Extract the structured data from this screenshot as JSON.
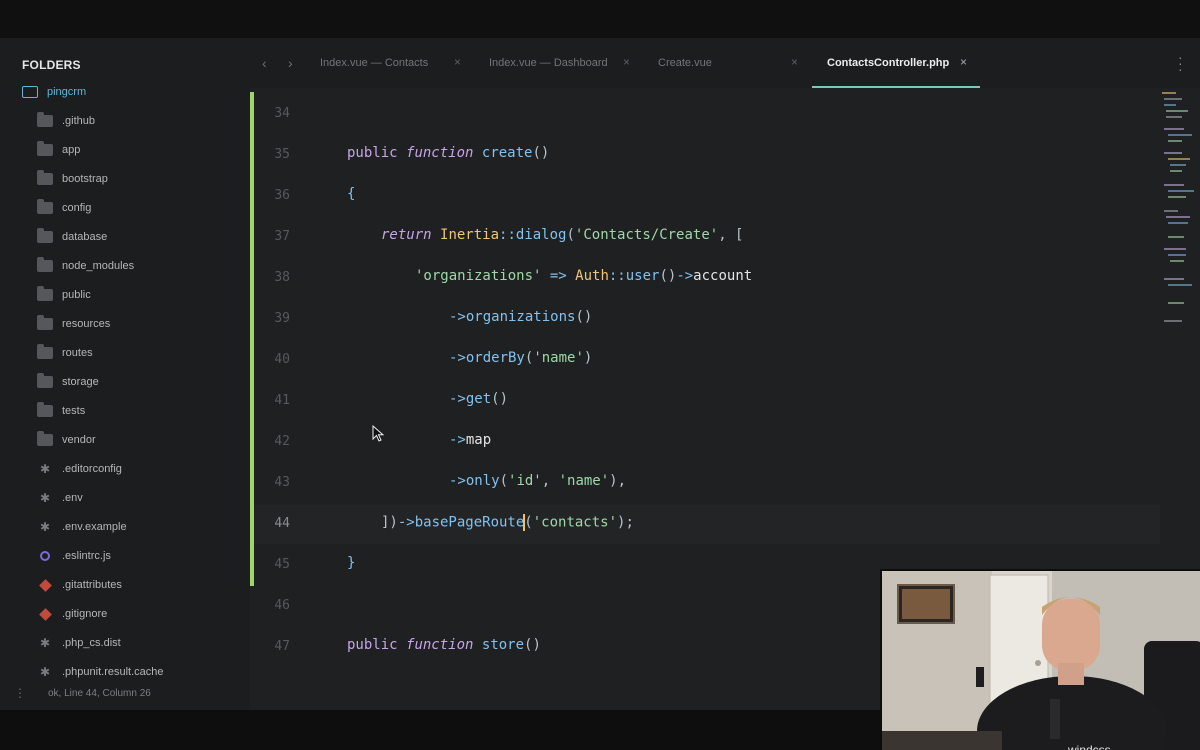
{
  "sidebar": {
    "header": "FOLDERS",
    "root": "pingcrm",
    "items": [
      {
        "label": ".github",
        "icon": "folder-icon"
      },
      {
        "label": "app",
        "icon": "folder-icon"
      },
      {
        "label": "bootstrap",
        "icon": "folder-icon"
      },
      {
        "label": "config",
        "icon": "folder-icon"
      },
      {
        "label": "database",
        "icon": "folder-icon"
      },
      {
        "label": "node_modules",
        "icon": "folder-icon"
      },
      {
        "label": "public",
        "icon": "folder-icon"
      },
      {
        "label": "resources",
        "icon": "folder-icon"
      },
      {
        "label": "routes",
        "icon": "folder-icon"
      },
      {
        "label": "storage",
        "icon": "folder-icon"
      },
      {
        "label": "tests",
        "icon": "folder-icon"
      },
      {
        "label": "vendor",
        "icon": "folder-icon"
      },
      {
        "label": ".editorconfig",
        "icon": "file-star-icon"
      },
      {
        "label": ".env",
        "icon": "file-star-icon"
      },
      {
        "label": ".env.example",
        "icon": "file-star-icon"
      },
      {
        "label": ".eslintrc.js",
        "icon": "eslint-icon"
      },
      {
        "label": ".gitattributes",
        "icon": "git-icon"
      },
      {
        "label": ".gitignore",
        "icon": "git-icon"
      },
      {
        "label": ".php_cs.dist",
        "icon": "file-star-icon"
      },
      {
        "label": ".phpunit.result.cache",
        "icon": "file-star-icon"
      }
    ]
  },
  "status": {
    "text": "ok, Line 44, Column 26"
  },
  "tabs": [
    {
      "label": "Index.vue — Contacts",
      "active": false
    },
    {
      "label": "Index.vue — Dashboard",
      "active": false
    },
    {
      "label": "Create.vue",
      "active": false
    },
    {
      "label": "ContactsController.php",
      "active": true
    }
  ],
  "editor": {
    "line_numbers": [
      "34",
      "35",
      "36",
      "37",
      "38",
      "39",
      "40",
      "41",
      "42",
      "43",
      "44",
      "45",
      "46",
      "47"
    ],
    "current_line": "44",
    "lines": {
      "l35": {
        "kw": "public",
        "kw2": "function",
        "fn": "create",
        "p": "()"
      },
      "l36": {
        "p": "{"
      },
      "l37": {
        "kw": "return",
        "cls": "Inertia",
        "op": "::",
        "fn": "dialog",
        "p1": "(",
        "str": "'Contacts/Create'",
        "p2": ", ["
      },
      "l38": {
        "str": "'organizations'",
        "op": " => ",
        "cls": "Auth",
        "op2": "::",
        "fn": "user",
        "p1": "()",
        "op3": "->",
        "id": "account"
      },
      "l39": {
        "op": "->",
        "fn": "organizations",
        "p": "()"
      },
      "l40": {
        "op": "->",
        "fn": "orderBy",
        "p1": "(",
        "str": "'name'",
        "p2": ")"
      },
      "l41": {
        "op": "->",
        "fn": "get",
        "p": "()"
      },
      "l42": {
        "op": "->",
        "id": "map"
      },
      "l43": {
        "op": "->",
        "fn": "only",
        "p1": "(",
        "str1": "'id'",
        "p2": ", ",
        "str2": "'name'",
        "p3": "),"
      },
      "l44": {
        "p1": "])",
        "op": "->",
        "fn1": "basePageRoute",
        "p2": "(",
        "str": "'contacts'",
        "p3": ");"
      },
      "l45": {
        "p": "}"
      },
      "l47": {
        "kw": "public",
        "kw2": "function",
        "fn": "store",
        "p": "()"
      }
    }
  },
  "colors": {
    "accent": "#7cc6c4",
    "gutter_changed": "#9ed66b",
    "keyword": "#c7a3e8",
    "function": "#82c2ee",
    "class": "#f0c674",
    "string": "#9fd8a8"
  }
}
